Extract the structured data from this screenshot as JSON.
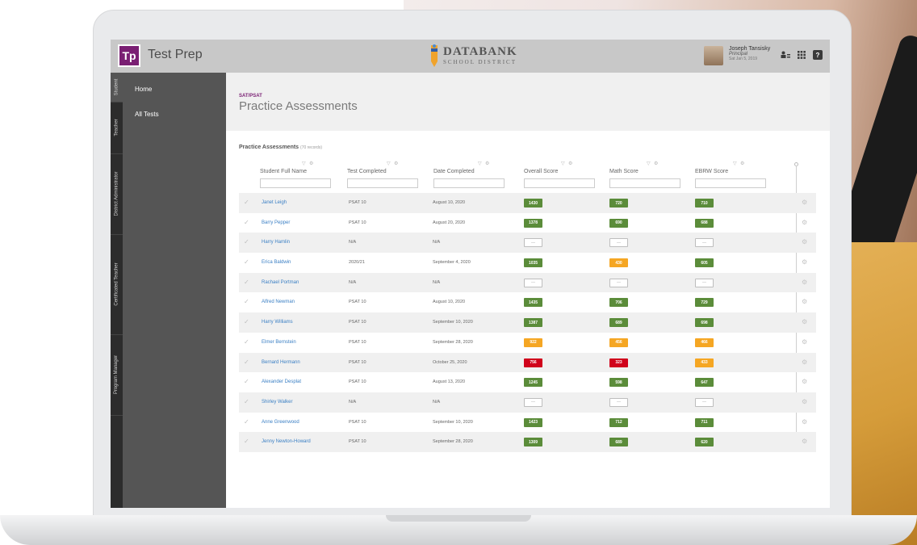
{
  "header": {
    "app_logo": "Tp",
    "app_title": "Test Prep",
    "brand_name": "DATABANK",
    "brand_sub": "SCHOOL DISTRICT",
    "user": {
      "name": "Joseph Tansisky",
      "role": "Principal",
      "date": "Sat Jan 5, 2019"
    },
    "icons": [
      "user-switch-icon",
      "apps-grid-icon",
      "help-icon"
    ],
    "help_glyph": "?"
  },
  "roles": [
    "Student",
    "Teacher",
    "District Administrator",
    "Certificated Teacher",
    "Program Manager"
  ],
  "sidebar": {
    "items": [
      {
        "label": "Home"
      },
      {
        "label": "All Tests"
      }
    ]
  },
  "page": {
    "kicker": "SAT/PSAT",
    "title": "Practice Assessments"
  },
  "table": {
    "title": "Practice Assessments",
    "count": "(70 records)",
    "columns": [
      "Student Full Name",
      "Test Completed",
      "Date Completed",
      "Overall Score",
      "Math Score",
      "EBRW Score"
    ],
    "rows": [
      {
        "name": "Janet Leigh",
        "test": "PSAT 10",
        "date": "August 10, 2020",
        "overall": "1430",
        "math": "720",
        "ebrw": "710",
        "c": [
          "g",
          "g",
          "g"
        ]
      },
      {
        "name": "Barry Pepper",
        "test": "PSAT 10",
        "date": "August 20, 2020",
        "overall": "1378",
        "math": "690",
        "ebrw": "688",
        "c": [
          "g",
          "g",
          "g"
        ]
      },
      {
        "name": "Harry Hamlin",
        "test": "N/A",
        "date": "N/A",
        "overall": "—",
        "math": "—",
        "ebrw": "—",
        "c": [
          "e",
          "e",
          "e"
        ]
      },
      {
        "name": "Erica Baldwin",
        "test": "2020/21",
        "date": "September 4, 2020",
        "overall": "1035",
        "math": "430",
        "ebrw": "605",
        "c": [
          "g",
          "o",
          "g"
        ]
      },
      {
        "name": "Rachael Portman",
        "test": "N/A",
        "date": "N/A",
        "overall": "—",
        "math": "—",
        "ebrw": "—",
        "c": [
          "e",
          "e",
          "e"
        ]
      },
      {
        "name": "Alfred Newman",
        "test": "PSAT 10",
        "date": "August 10, 2020",
        "overall": "1435",
        "math": "706",
        "ebrw": "729",
        "c": [
          "g",
          "g",
          "g"
        ]
      },
      {
        "name": "Harry Williams",
        "test": "PSAT 10",
        "date": "September 10, 2020",
        "overall": "1387",
        "math": "689",
        "ebrw": "698",
        "c": [
          "g",
          "g",
          "g"
        ]
      },
      {
        "name": "Elmer Bernstein",
        "test": "PSAT 10",
        "date": "September 28, 2020",
        "overall": "922",
        "math": "456",
        "ebrw": "466",
        "c": [
          "o",
          "o",
          "o"
        ]
      },
      {
        "name": "Bernard Hermann",
        "test": "PSAT 10",
        "date": "October 25, 2020",
        "overall": "756",
        "math": "323",
        "ebrw": "433",
        "c": [
          "r",
          "r",
          "o"
        ]
      },
      {
        "name": "Alexander Desplat",
        "test": "PSAT 10",
        "date": "August 13, 2020",
        "overall": "1245",
        "math": "598",
        "ebrw": "647",
        "c": [
          "g",
          "g",
          "g"
        ]
      },
      {
        "name": "Shirley Walker",
        "test": "N/A",
        "date": "N/A",
        "overall": "—",
        "math": "—",
        "ebrw": "—",
        "c": [
          "e",
          "e",
          "e"
        ]
      },
      {
        "name": "Anne Greenwood",
        "test": "PSAT 10",
        "date": "September 10, 2020",
        "overall": "1423",
        "math": "712",
        "ebrw": "711",
        "c": [
          "g",
          "g",
          "g"
        ]
      },
      {
        "name": "Jenny Newton-Howard",
        "test": "PSAT 10",
        "date": "September 28, 2020",
        "overall": "1309",
        "math": "689",
        "ebrw": "620",
        "c": [
          "g",
          "g",
          "g"
        ]
      }
    ]
  },
  "colors": {
    "g": "#5b8c3a",
    "o": "#f5a623",
    "r": "#d0021b",
    "accent": "#7a1f73",
    "link": "#3a7fc4"
  }
}
